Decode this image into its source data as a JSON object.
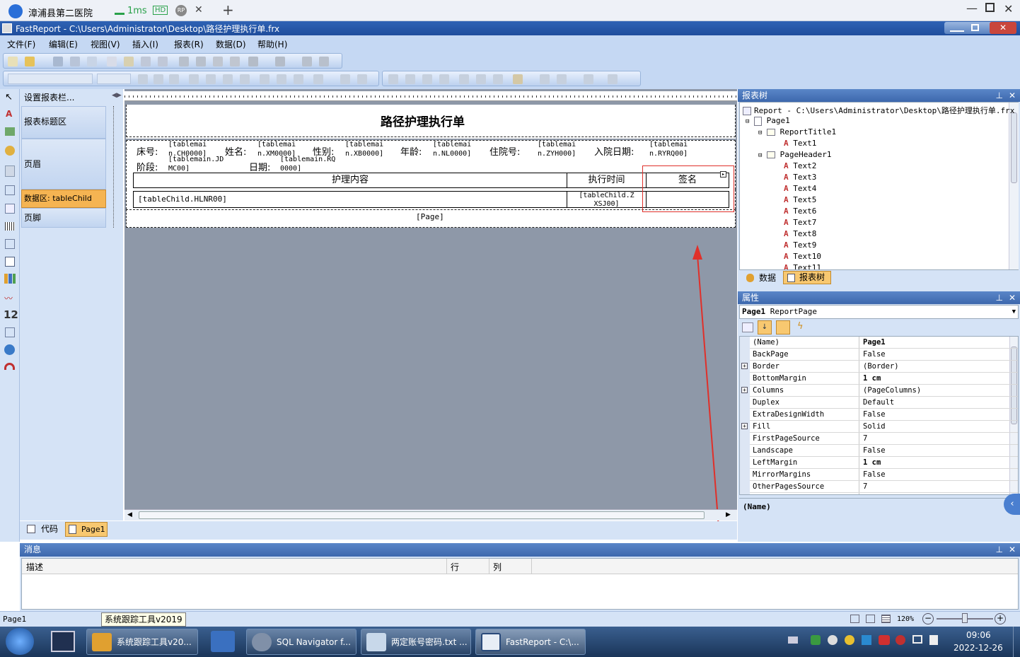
{
  "remote": {
    "title": "漳浦县第二医院",
    "latency": "1ms",
    "hd": "HD",
    "rp": "RP",
    "close": "✕",
    "add": "+"
  },
  "window": {
    "title": "FastReport - C:\\Users\\Administrator\\Desktop\\路径护理执行单.frx"
  },
  "menu": [
    "文件(F)",
    "编辑(E)",
    "视图(V)",
    "插入(I)",
    "报表(R)",
    "数据(D)",
    "帮助(H)"
  ],
  "bands_header": "设置报表栏...",
  "bands": {
    "report_title": "报表标题区",
    "page_header": "页眉",
    "data": "数据区: tableChild",
    "page_footer": "页脚"
  },
  "report": {
    "title": "路径护理执行单",
    "labels": {
      "bed": "床号:",
      "name": "姓名:",
      "sex": "性别:",
      "age": "年龄:",
      "inpatient": "住院号:",
      "admit_date": "入院日期:",
      "stage": "阶段:",
      "date": "日期:"
    },
    "fields": {
      "bed_a": "[tablemai",
      "bed_b": "n.CH0000]",
      "name_a": "[tablemai",
      "name_b": "n.XM0000]",
      "sex_a": "[tablemai",
      "sex_b": "n.XB0000]",
      "age_a": "[tablemai",
      "age_b": "n.NL0000]",
      "inp_a": "[tablemai",
      "inp_b": "n.ZYH000]",
      "adm_a": "[tablemai",
      "adm_b": "n.RYRQ00]",
      "stage_a": "[tablemain.JD",
      "stage_b": "MC00]",
      "date_a": "[tablemain.RQ",
      "date_b": "0000]"
    },
    "headers": {
      "content": "护理内容",
      "time": "执行时间",
      "sign": "签名"
    },
    "row": {
      "content": "[tableChild.HLNR00]",
      "time_a": "[tableChild.Z",
      "time_b": "XSJ00]"
    },
    "footer": "[Page]"
  },
  "tabs": {
    "code": "代码",
    "page": "Page1"
  },
  "tree": {
    "title": "报表树",
    "items": [
      "Report - C:\\Users\\Administrator\\Desktop\\路径护理执行单.frx",
      "Page1",
      "ReportTitle1",
      "Text1",
      "PageHeader1",
      "Text2",
      "Text3",
      "Text4",
      "Text5",
      "Text6",
      "Text7",
      "Text8",
      "Text9",
      "Text10",
      "Text11"
    ],
    "tab_data": "数据",
    "tab_tree": "报表树"
  },
  "props": {
    "title": "属性",
    "object": "Page1",
    "object_type": "ReportPage",
    "rows": [
      {
        "name": "(Name)",
        "value": "Page1",
        "plus": false
      },
      {
        "name": "BackPage",
        "value": "False",
        "plus": false
      },
      {
        "name": "Border",
        "value": "(Border)",
        "plus": true
      },
      {
        "name": "BottomMargin",
        "value": "1 cm",
        "plus": false
      },
      {
        "name": "Columns",
        "value": "(PageColumns)",
        "plus": true
      },
      {
        "name": "Duplex",
        "value": "Default",
        "plus": false
      },
      {
        "name": "ExtraDesignWidth",
        "value": "False",
        "plus": false
      },
      {
        "name": "Fill",
        "value": "Solid",
        "plus": true
      },
      {
        "name": "FirstPageSource",
        "value": "7",
        "plus": false
      },
      {
        "name": "Landscape",
        "value": "False",
        "plus": false
      },
      {
        "name": "LeftMargin",
        "value": "1 cm",
        "plus": false
      },
      {
        "name": "MirrorMargins",
        "value": "False",
        "plus": false
      },
      {
        "name": "OtherPagesSource",
        "value": "7",
        "plus": false
      }
    ],
    "desc": "(Name)"
  },
  "messages": {
    "title": "消息",
    "col_desc": "描述",
    "col_row": "行",
    "col_col": "列"
  },
  "status": {
    "page": "Page1",
    "tooltip": "系统跟踪工具v2019",
    "zoom": "120%"
  },
  "taskbar": {
    "tasks": [
      "系统跟踪工具v20...",
      "SQL Navigator f...",
      "两定账号密码.txt ...",
      "FastReport - C:\\..."
    ],
    "time": "09:06",
    "date": "2022-12-26"
  },
  "colors": {
    "accent": "#3d68ad",
    "annotation": "#e0302a",
    "active_band": "#f5b452"
  }
}
